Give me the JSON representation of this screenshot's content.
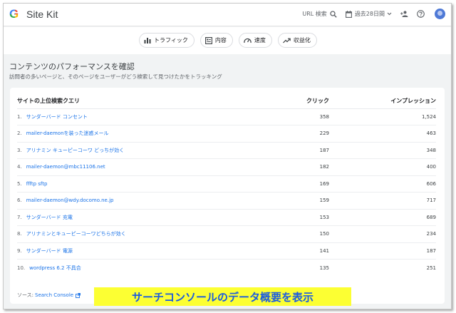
{
  "header": {
    "brand": "Site Kit",
    "url_search_label": "URL 検索",
    "date_range": "過去28日間"
  },
  "nav": {
    "tabs": [
      {
        "label": "トラフィック",
        "icon": "bar-chart-icon"
      },
      {
        "label": "内容",
        "icon": "content-icon"
      },
      {
        "label": "速度",
        "icon": "speed-icon"
      },
      {
        "label": "収益化",
        "icon": "trending-up-icon"
      }
    ]
  },
  "section": {
    "title": "コンテンツのパフォーマンスを確認",
    "subtitle": "訪問者の多いページと、そのページをユーザーがどう検索して見つけたかをトラッキング"
  },
  "table": {
    "headers": [
      "サイトの上位検索クエリ",
      "クリック",
      "インプレッション"
    ],
    "rows": [
      {
        "num": "1.",
        "query": "サンダーバード コンセント",
        "clicks": "358",
        "impressions": "1,524"
      },
      {
        "num": "2.",
        "query": "mailer-daemonを装った迷惑メール",
        "clicks": "229",
        "impressions": "463"
      },
      {
        "num": "3.",
        "query": "アリナミン キューピーコーワ どっちが効く",
        "clicks": "187",
        "impressions": "348"
      },
      {
        "num": "4.",
        "query": "mailer-daemon@mbc11106.net",
        "clicks": "182",
        "impressions": "400"
      },
      {
        "num": "5.",
        "query": "ffftp sftp",
        "clicks": "169",
        "impressions": "606"
      },
      {
        "num": "6.",
        "query": "mailer-daemon@wdy.docomo.ne.jp",
        "clicks": "159",
        "impressions": "717"
      },
      {
        "num": "7.",
        "query": "サンダーバード 充電",
        "clicks": "153",
        "impressions": "689"
      },
      {
        "num": "8.",
        "query": "アリナミンとキューピーコーワどちらが効く",
        "clicks": "150",
        "impressions": "234"
      },
      {
        "num": "9.",
        "query": "サンダーバード 電源",
        "clicks": "141",
        "impressions": "187"
      },
      {
        "num": "10.",
        "query": "wordpress 6.2 不具合",
        "clicks": "135",
        "impressions": "251"
      }
    ]
  },
  "source": {
    "prefix": "ソース:",
    "name": "Search Console"
  },
  "banner": {
    "text": "サーチコンソールのデータ概要を表示",
    "bg_color": "#fcff33",
    "text_color": "#1a5be0"
  }
}
